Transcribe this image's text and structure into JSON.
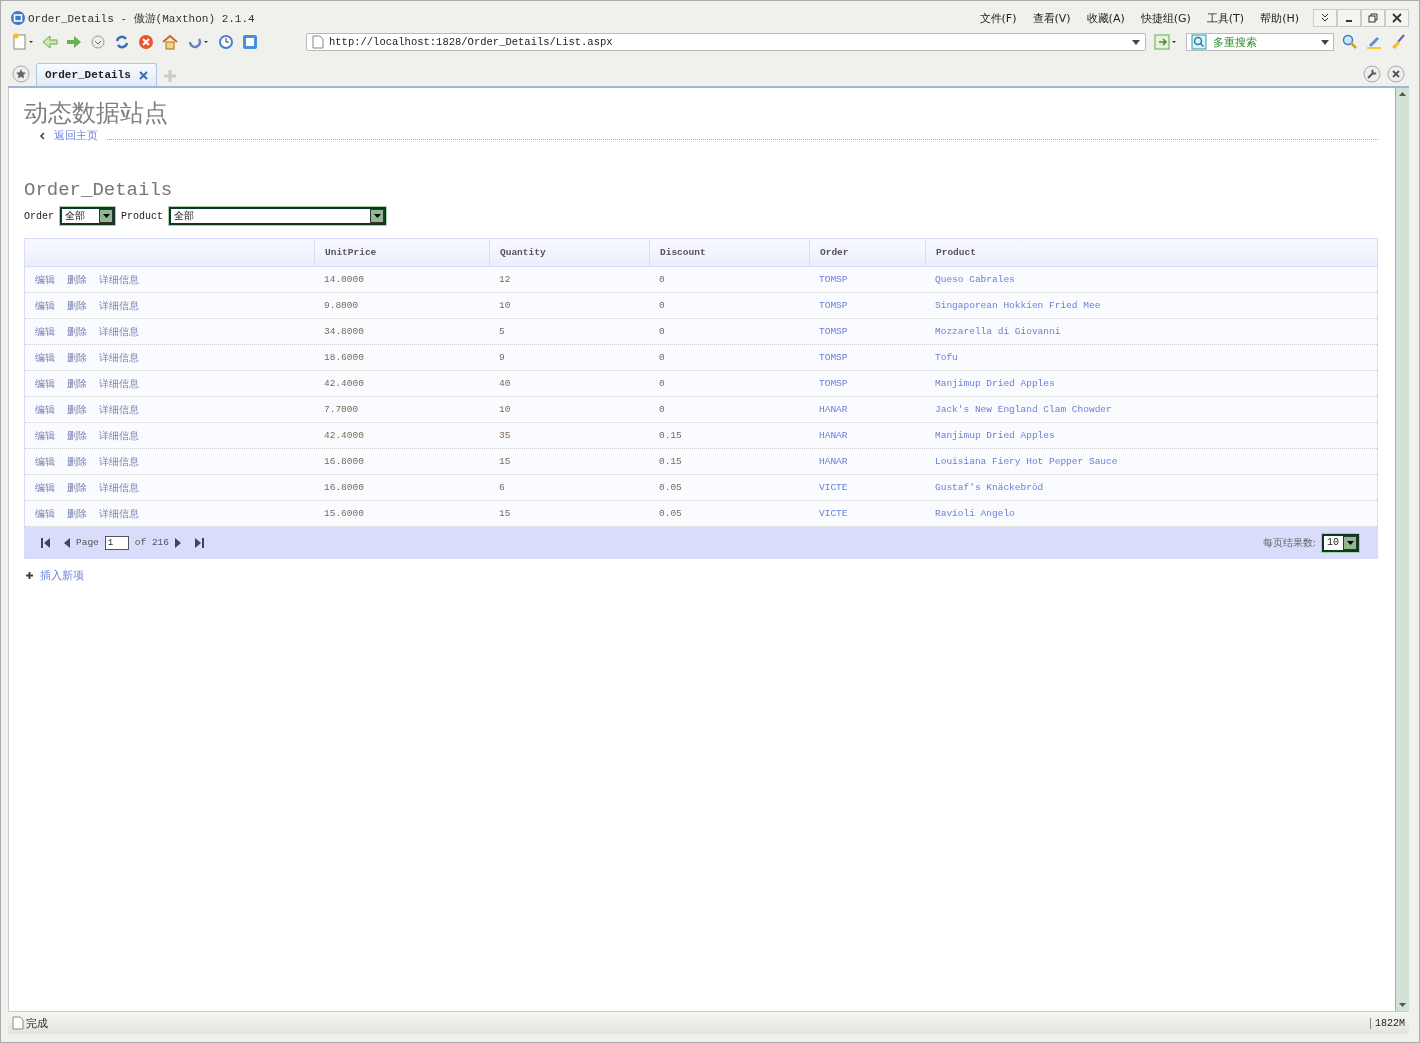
{
  "window": {
    "title": "Order_Details - 傲游(Maxthon) 2.1.4"
  },
  "menu": [
    "文件(F)",
    "查看(V)",
    "收藏(A)",
    "快捷组(G)",
    "工具(T)",
    "帮助(H)"
  ],
  "address": {
    "value": "http://localhost:1828/Order_Details/List.aspx"
  },
  "search": {
    "engine": "多重搜索"
  },
  "tabs": [
    {
      "label": "Order_Details",
      "selected": true
    }
  ],
  "page": {
    "site_title": "动态数据站点",
    "back_link": "返回主页",
    "heading": "Order_Details",
    "filters": [
      {
        "label": "Order",
        "value": "全部"
      },
      {
        "label": "Product",
        "value": "全部"
      }
    ],
    "table": {
      "columns": [
        "UnitPrice",
        "Quantity",
        "Discount",
        "Order",
        "Product"
      ],
      "rows": [
        {
          "actions": [
            "编辑",
            "删除",
            "详细信息"
          ],
          "unit_price": "14.0000",
          "quantity": "12",
          "discount": "0",
          "order": "TOMSP",
          "product": "Queso Cabrales"
        },
        {
          "actions": [
            "编辑",
            "删除",
            "详细信息"
          ],
          "unit_price": "9.8000",
          "quantity": "10",
          "discount": "0",
          "order": "TOMSP",
          "product": "Singaporean Hokkien Fried Mee"
        },
        {
          "actions": [
            "编辑",
            "删除",
            "详细信息"
          ],
          "unit_price": "34.8000",
          "quantity": "5",
          "discount": "0",
          "order": "TOMSP",
          "product": "Mozzarella di Giovanni"
        },
        {
          "actions": [
            "编辑",
            "删除",
            "详细信息"
          ],
          "unit_price": "18.6000",
          "quantity": "9",
          "discount": "0",
          "order": "TOMSP",
          "product": "Tofu"
        },
        {
          "actions": [
            "编辑",
            "删除",
            "详细信息"
          ],
          "unit_price": "42.4000",
          "quantity": "40",
          "discount": "0",
          "order": "TOMSP",
          "product": "Manjimup Dried Apples"
        },
        {
          "actions": [
            "编辑",
            "删除",
            "详细信息"
          ],
          "unit_price": "7.7000",
          "quantity": "10",
          "discount": "0",
          "order": "HANAR",
          "product": "Jack's New England Clam Chowder"
        },
        {
          "actions": [
            "编辑",
            "删除",
            "详细信息"
          ],
          "unit_price": "42.4000",
          "quantity": "35",
          "discount": "0.15",
          "order": "HANAR",
          "product": "Manjimup Dried Apples"
        },
        {
          "actions": [
            "编辑",
            "删除",
            "详细信息"
          ],
          "unit_price": "16.8000",
          "quantity": "15",
          "discount": "0.15",
          "order": "HANAR",
          "product": "Louisiana Fiery Hot Pepper Sauce"
        },
        {
          "actions": [
            "编辑",
            "删除",
            "详细信息"
          ],
          "unit_price": "16.8000",
          "quantity": "6",
          "discount": "0.05",
          "order": "VICTE",
          "product": "Gustaf's Knäckebröd"
        },
        {
          "actions": [
            "编辑",
            "删除",
            "详细信息"
          ],
          "unit_price": "15.6000",
          "quantity": "15",
          "discount": "0.05",
          "order": "VICTE",
          "product": "Ravioli Angelo"
        }
      ]
    },
    "pager": {
      "page_label": "Page",
      "page_value": "1",
      "of_label": "of 216",
      "page_size_label": "每页结果数:",
      "page_size": "10"
    },
    "insert_link": "插入新项"
  },
  "status_bar": {
    "text": "完成",
    "memory": "1822M"
  }
}
